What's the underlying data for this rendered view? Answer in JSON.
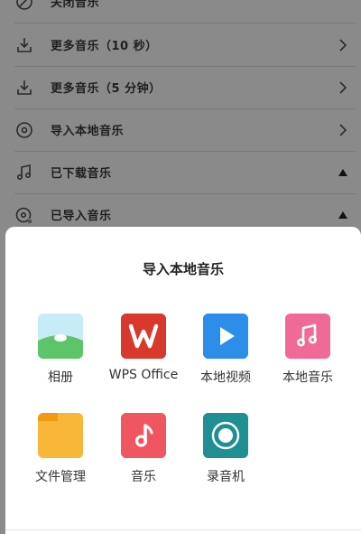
{
  "background_list": {
    "items": [
      {
        "label": "关闭音乐",
        "icon": "no-music-icon",
        "end": "none"
      },
      {
        "label": "更多音乐（10 秒）",
        "icon": "download-icon",
        "end": "chevron-right-icon"
      },
      {
        "label": "更多音乐（5 分钟）",
        "icon": "download-icon",
        "end": "chevron-right-icon"
      },
      {
        "label": "导入本地音乐",
        "icon": "disc-icon",
        "end": "chevron-right-icon"
      },
      {
        "label": "已下载音乐",
        "icon": "music-note-icon",
        "end": "triangle-up-icon"
      },
      {
        "label": "已导入音乐",
        "icon": "disc-import-icon",
        "end": "triangle-up-icon"
      }
    ]
  },
  "sheet": {
    "title": "导入本地音乐",
    "apps": [
      {
        "label": "相册",
        "icon": "gallery-icon",
        "color": "#5dc46a"
      },
      {
        "label": "WPS Office",
        "icon": "wps-icon",
        "color": "#d9382c"
      },
      {
        "label": "本地视频",
        "icon": "play-icon",
        "color": "#2c8ee8"
      },
      {
        "label": "本地音乐",
        "icon": "music-icon",
        "color": "#f06a98"
      },
      {
        "label": "文件管理",
        "icon": "folder-icon",
        "color": "#f6a623"
      },
      {
        "label": "音乐",
        "icon": "music-note-icon",
        "color": "#ef5661"
      },
      {
        "label": "录音机",
        "icon": "recorder-icon",
        "color": "#1f8f92"
      }
    ]
  }
}
